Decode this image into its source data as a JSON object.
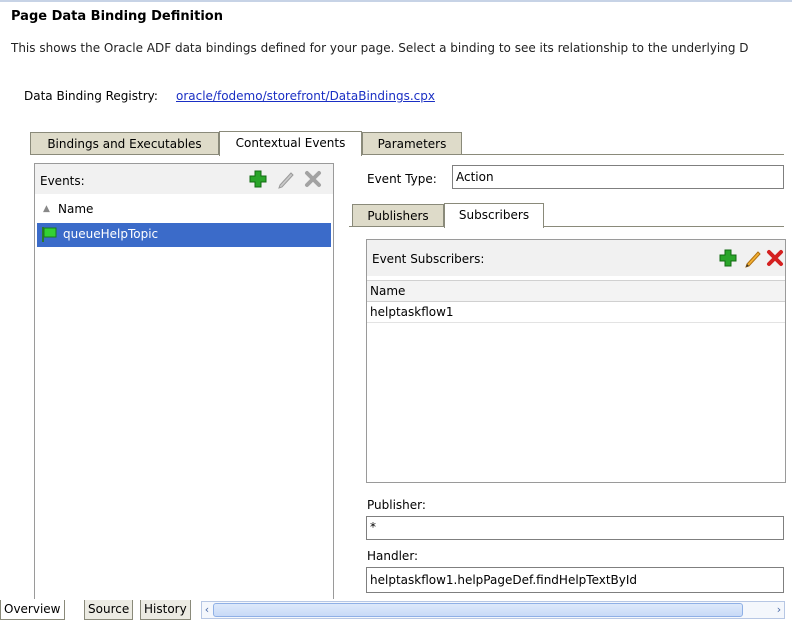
{
  "page": {
    "title": "Page Data Binding Definition",
    "description": "This shows the Oracle ADF data bindings defined for your page. Select a binding to see its relationship to the underlying D",
    "registry_label": "Data Binding Registry:",
    "registry_link": "oracle/fodemo/storefront/DataBindings.cpx"
  },
  "tabs": [
    {
      "label": "Bindings and Executables",
      "active": false
    },
    {
      "label": "Contextual Events",
      "active": true
    },
    {
      "label": "Parameters",
      "active": false
    }
  ],
  "events": {
    "label": "Events:",
    "column": "Name",
    "items": [
      {
        "name": "queueHelpTopic",
        "selected": true
      }
    ]
  },
  "event_type": {
    "label": "Event Type:",
    "value": "Action"
  },
  "subtabs": [
    {
      "label": "Publishers",
      "active": false
    },
    {
      "label": "Subscribers",
      "active": true
    }
  ],
  "subscribers": {
    "label": "Event Subscribers:",
    "column": "Name",
    "rows": [
      "helptaskflow1"
    ]
  },
  "publisher": {
    "label": "Publisher:",
    "value": "*"
  },
  "handler": {
    "label": "Handler:",
    "value": "helptaskflow1.helpPageDef.findHelpTextById"
  },
  "bottom_tabs": [
    {
      "label": "Overview",
      "active": true
    },
    {
      "label": "Source",
      "active": false
    },
    {
      "label": "History",
      "active": false
    }
  ],
  "colors": {
    "selection": "#3b6bc9",
    "link": "#1a2fc4",
    "add_icon": "#2aa52a",
    "delete_icon": "#d42020"
  }
}
